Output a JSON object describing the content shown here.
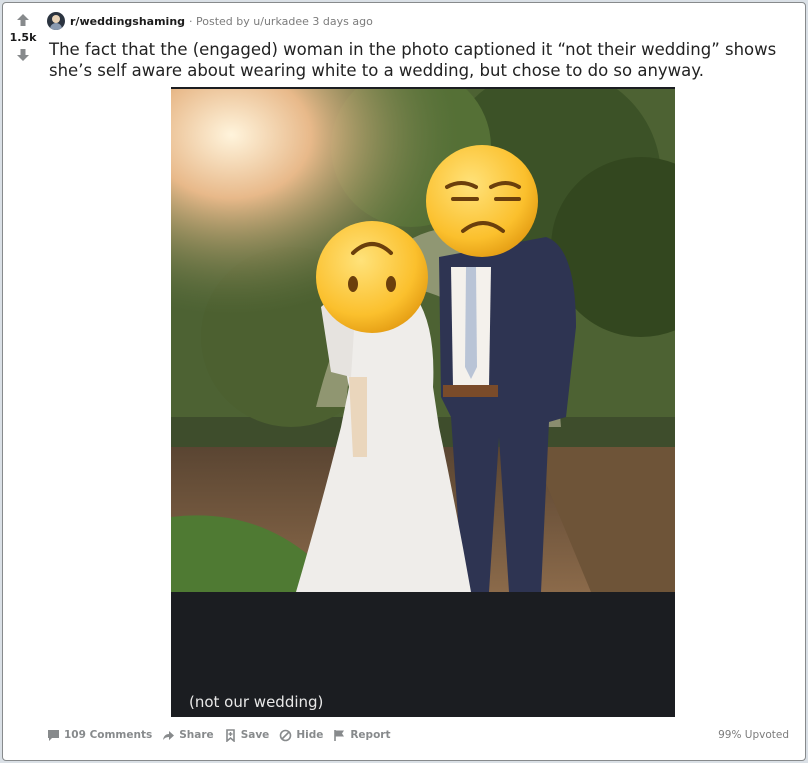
{
  "post": {
    "score": "1.5k",
    "subreddit": "r/weddingshaming",
    "posted_by": "· Posted by",
    "username": "u/urkadee",
    "time": "3 days ago",
    "title": "The fact that the (engaged) woman in the photo captioned it “not their wedding” shows she’s self aware about wearing white to a wedding, but chose to do so anyway.",
    "image_caption": "(not our wedding)",
    "upvote_ratio": "99% Upvoted"
  },
  "actions": {
    "comments": "109 Comments",
    "share": "Share",
    "save": "Save",
    "hide": "Hide",
    "report": "Report"
  },
  "icons": {
    "upvote": "upvote-arrow-icon",
    "downvote": "downvote-arrow-icon",
    "comments": "comment-bubble-icon",
    "share": "share-arrow-icon",
    "save": "bookmark-icon",
    "hide": "hide-circle-slash-icon",
    "report": "flag-icon"
  },
  "colors": {
    "card_border": "#878a8c",
    "action_gray": "#878a8c",
    "media_bg": "#1b1d21"
  }
}
